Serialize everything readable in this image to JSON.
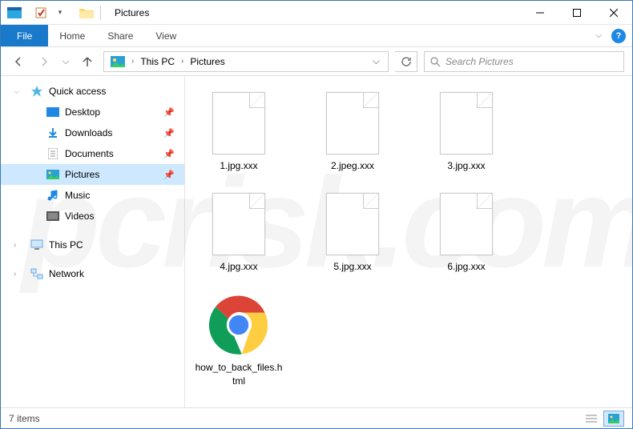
{
  "window": {
    "title": "Pictures"
  },
  "tabs": {
    "file": "File",
    "home": "Home",
    "share": "Share",
    "view": "View"
  },
  "breadcrumb": {
    "root": "This PC",
    "current": "Pictures"
  },
  "search": {
    "placeholder": "Search Pictures"
  },
  "nav": {
    "quick_access": "Quick access",
    "desktop": "Desktop",
    "downloads": "Downloads",
    "documents": "Documents",
    "pictures": "Pictures",
    "music": "Music",
    "videos": "Videos",
    "this_pc": "This PC",
    "network": "Network"
  },
  "files": [
    {
      "name": "1.jpg.xxx",
      "type": "blank"
    },
    {
      "name": "2.jpeg.xxx",
      "type": "blank"
    },
    {
      "name": "3.jpg.xxx",
      "type": "blank"
    },
    {
      "name": "4.jpg.xxx",
      "type": "blank"
    },
    {
      "name": "5.jpg.xxx",
      "type": "blank"
    },
    {
      "name": "6.jpg.xxx",
      "type": "blank"
    },
    {
      "name": "how_to_back_files.html",
      "type": "chrome"
    }
  ],
  "status": {
    "count": "7 items"
  },
  "watermark": "pcrisk.com"
}
